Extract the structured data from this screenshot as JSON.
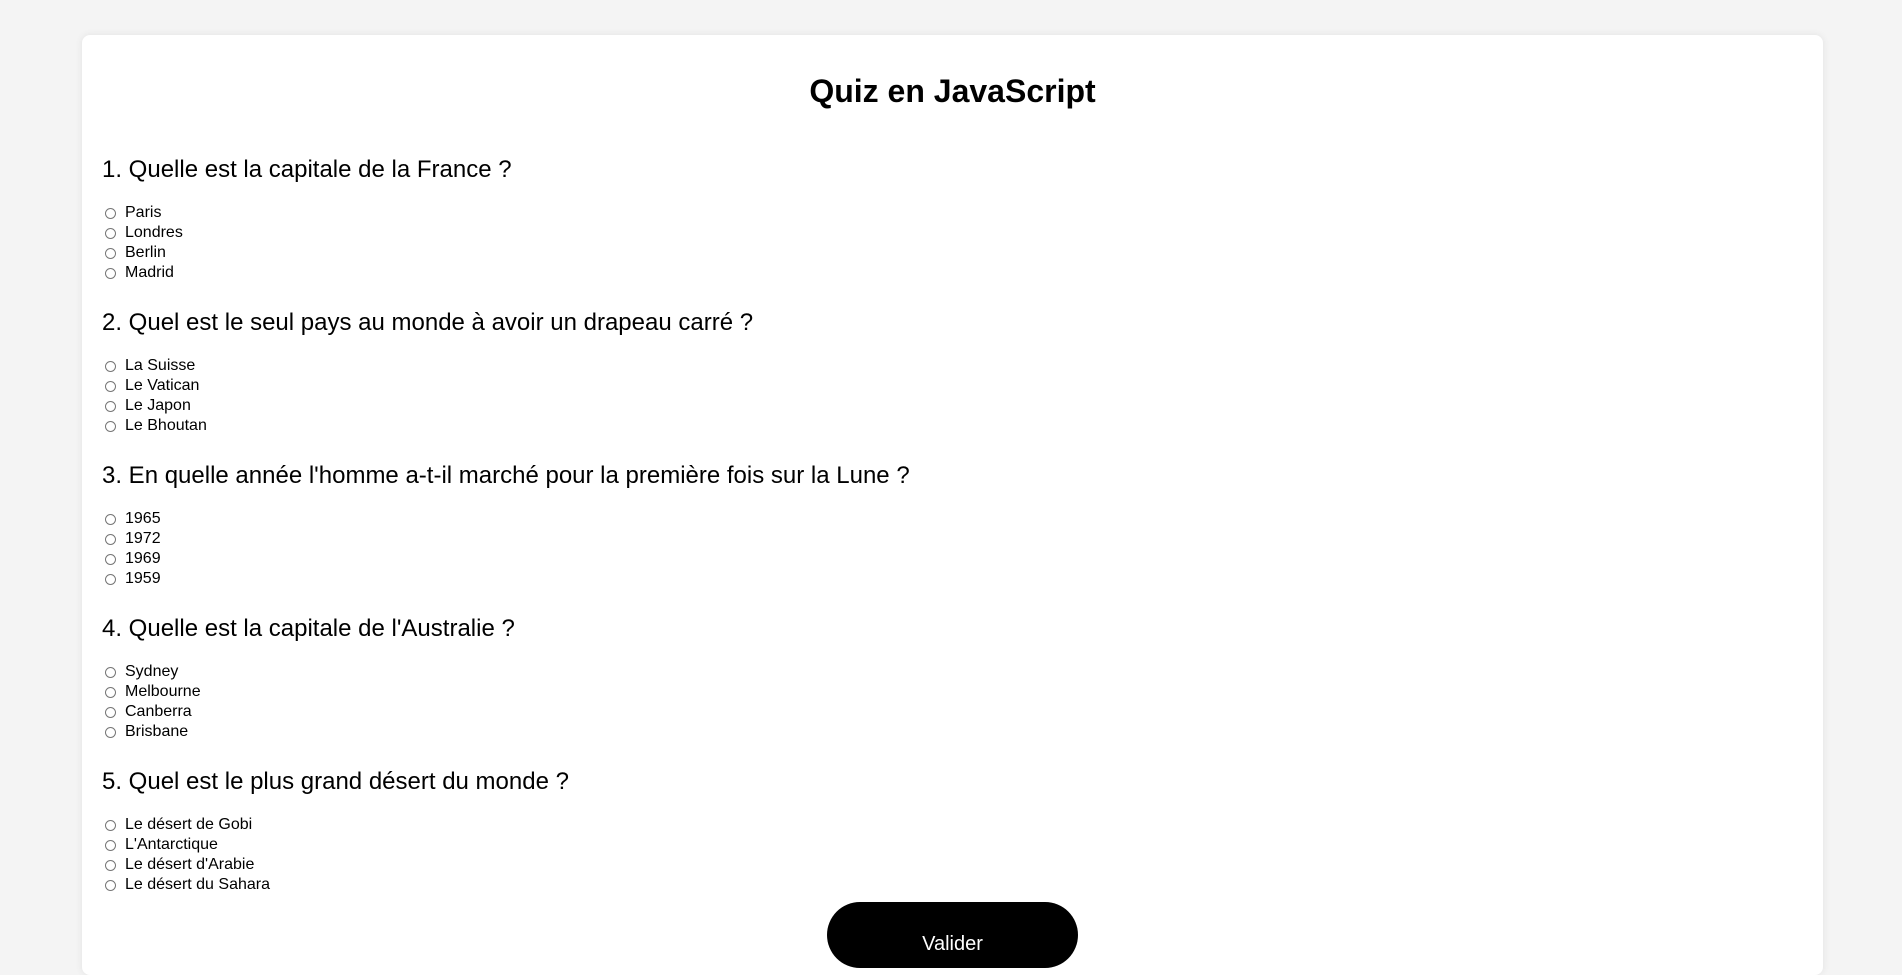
{
  "quiz": {
    "title": "Quiz en JavaScript",
    "submit_label": "Valider",
    "questions": [
      {
        "text": "1. Quelle est la capitale de la France ?",
        "options": [
          "Paris",
          "Londres",
          "Berlin",
          "Madrid"
        ]
      },
      {
        "text": "2. Quel est le seul pays au monde à avoir un drapeau carré ?",
        "options": [
          "La Suisse",
          "Le Vatican",
          "Le Japon",
          "Le Bhoutan"
        ]
      },
      {
        "text": "3. En quelle année l'homme a-t-il marché pour la première fois sur la Lune ?",
        "options": [
          "1965",
          "1972",
          "1969",
          "1959"
        ]
      },
      {
        "text": "4. Quelle est la capitale de l'Australie ?",
        "options": [
          "Sydney",
          "Melbourne",
          "Canberra",
          "Brisbane"
        ]
      },
      {
        "text": "5. Quel est le plus grand désert du monde ?",
        "options": [
          "Le désert de Gobi",
          "L'Antarctique",
          "Le désert d'Arabie",
          "Le désert du Sahara"
        ]
      }
    ]
  }
}
